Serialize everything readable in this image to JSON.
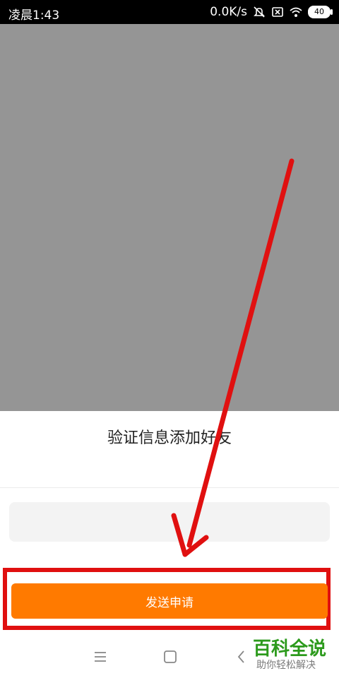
{
  "status_bar": {
    "time": "凌晨1:43",
    "network_speed": "0.0K/s",
    "battery": "40",
    "icons": [
      "mute-icon",
      "sim-icon",
      "wifi-icon",
      "battery-icon"
    ]
  },
  "dialog": {
    "title": "验证信息添加好友",
    "message_input": {
      "value": "",
      "placeholder": ""
    },
    "send_button_label": "发送申请"
  },
  "nav_bar": {
    "icons": [
      "menu-icon",
      "home-icon",
      "back-icon"
    ]
  },
  "watermark": {
    "title": "百科全说",
    "subtitle": "助你轻松解决"
  },
  "colors": {
    "overlay": "#959595",
    "button": "#ff7a00",
    "annotation": "#e01010",
    "watermark_green": "#2c9a1c"
  }
}
